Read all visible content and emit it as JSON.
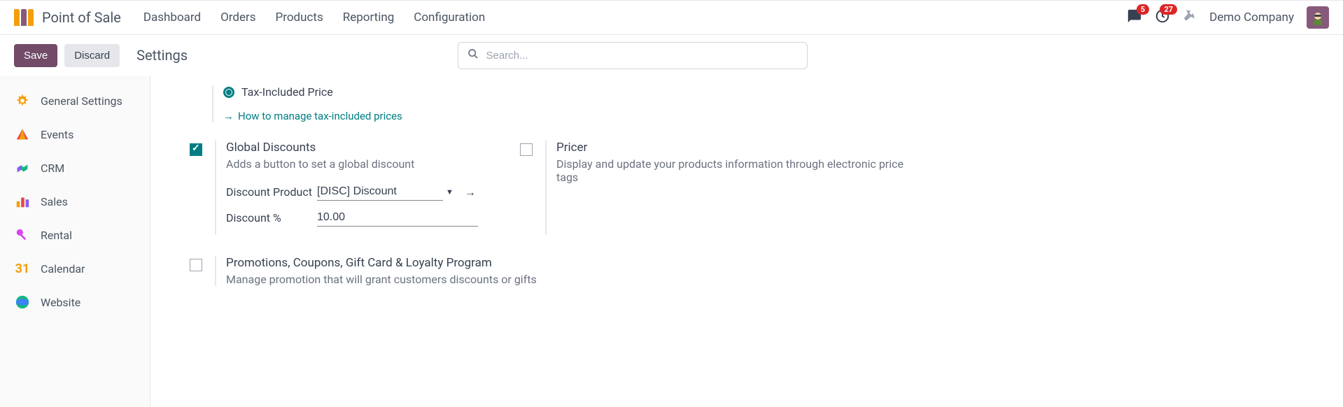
{
  "header": {
    "app_name": "Point of Sale",
    "menu": [
      "Dashboard",
      "Orders",
      "Products",
      "Reporting",
      "Configuration"
    ],
    "msg_count": "5",
    "activity_count": "27",
    "company": "Demo Company"
  },
  "actions": {
    "save": "Save",
    "discard": "Discard",
    "title": "Settings",
    "search_placeholder": "Search..."
  },
  "sidebar": {
    "items": [
      {
        "label": "General Settings"
      },
      {
        "label": "Events"
      },
      {
        "label": "CRM"
      },
      {
        "label": "Sales"
      },
      {
        "label": "Rental"
      },
      {
        "label": "Calendar"
      },
      {
        "label": "Website"
      }
    ]
  },
  "settings": {
    "tax_included": {
      "label": "Tax-Included Price",
      "link": "How to manage tax-included prices"
    },
    "global_discounts": {
      "title": "Global Discounts",
      "desc": "Adds a button to set a global discount",
      "discount_product_label": "Discount Product",
      "discount_product_value": "[DISC] Discount",
      "discount_pct_label": "Discount %",
      "discount_pct_value": "10.00"
    },
    "pricer": {
      "title": "Pricer",
      "desc": "Display and update your products information through electronic price tags"
    },
    "promo": {
      "title": "Promotions, Coupons, Gift Card & Loyalty Program",
      "desc": "Manage promotion that will grant customers discounts or gifts"
    }
  }
}
